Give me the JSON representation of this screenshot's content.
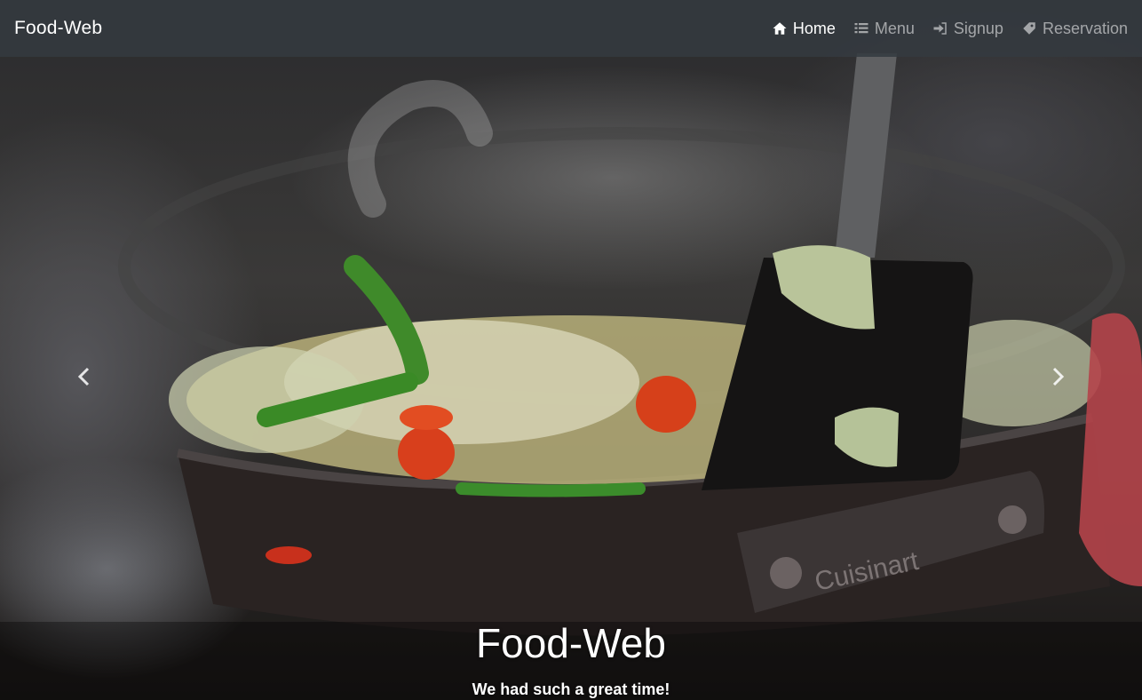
{
  "navbar": {
    "brand": "Food-Web",
    "items": [
      {
        "label": "Home",
        "icon": "home-icon",
        "active": true
      },
      {
        "label": "Menu",
        "icon": "list-icon",
        "active": false
      },
      {
        "label": "Signup",
        "icon": "sign-in-icon",
        "active": false
      },
      {
        "label": "Reservation",
        "icon": "tag-icon",
        "active": false
      }
    ]
  },
  "carousel": {
    "caption_title": "Food-Web",
    "caption_text": "We had such a great time!",
    "prev_icon": "chevron-left-icon",
    "next_icon": "chevron-right-icon"
  },
  "colors": {
    "navbar_bg": "#343a40",
    "nav_active": "#ffffff",
    "nav_inactive": "#9ea1a4"
  }
}
